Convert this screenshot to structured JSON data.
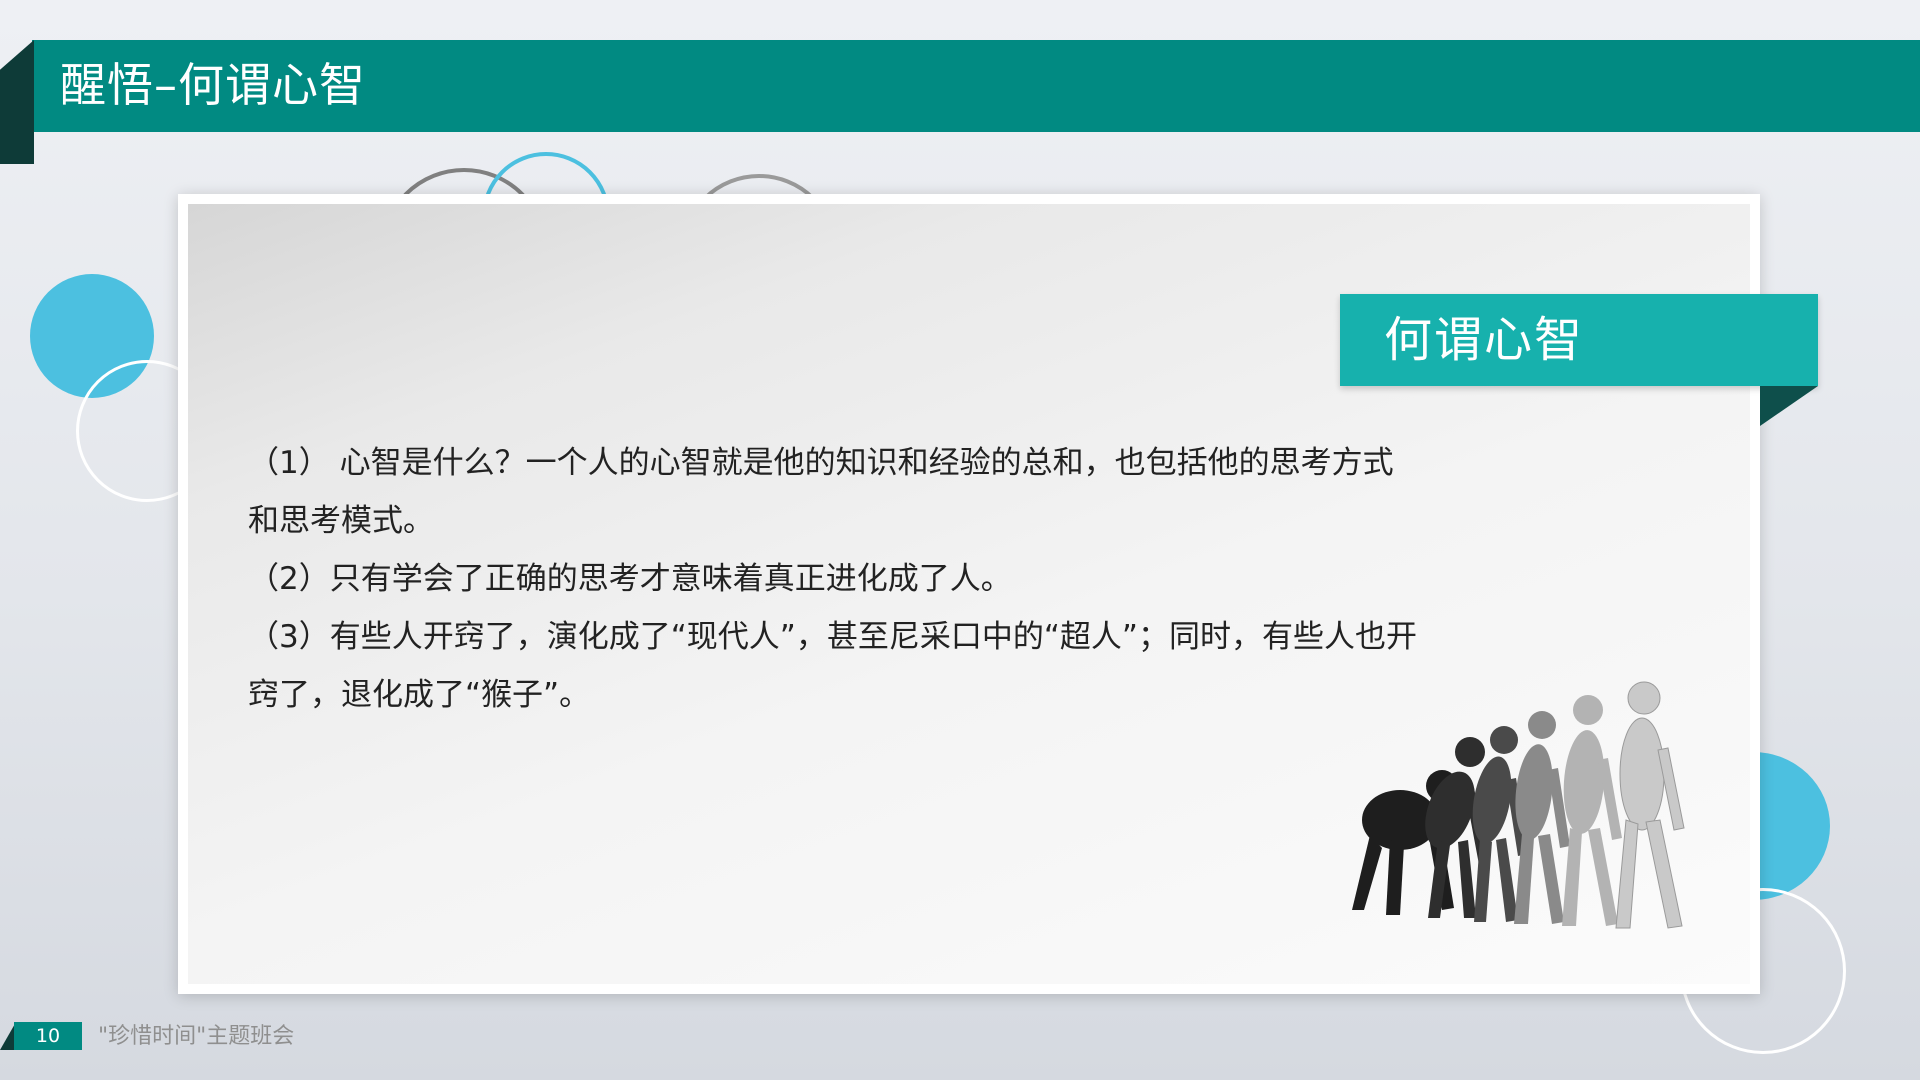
{
  "header": {
    "title": "醒悟–何谓心智"
  },
  "tag": {
    "title": "何谓心智"
  },
  "body": {
    "paragraphs": [
      "（1） 心智是什么？一个人的心智就是他的知识和经验的总和，也包括他的思考方式和思考模式。",
      "（2）只有学会了正确的思考才意味着真正进化成了人。",
      "（3）有些人开窍了，演化成了“现代人”，甚至尼采口中的“超人”；同时，有些人也开窍了，退化成了“猴子”。"
    ]
  },
  "illustration": {
    "icon": "human-evolution-figures"
  },
  "footer": {
    "page_number": "10",
    "text": "\"珍惜时间\"主题班会"
  },
  "colors": {
    "header_teal": "#018a82",
    "tag_teal": "#17b1ad",
    "accent_blue": "#4cc0e0",
    "dark_fold": "#0e3b38"
  }
}
